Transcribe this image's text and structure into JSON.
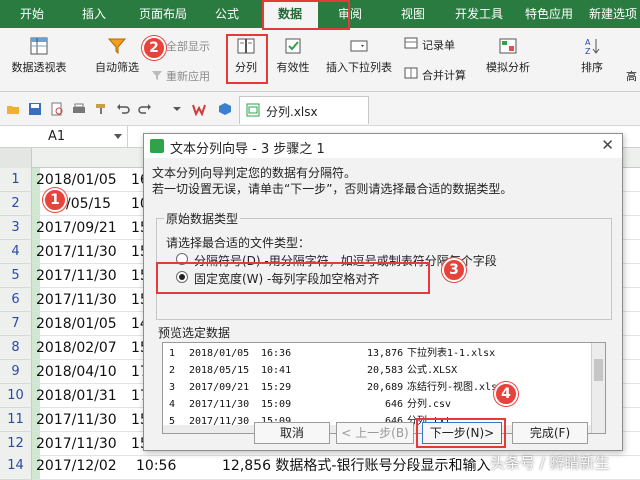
{
  "ribbon_tabs": [
    "开始",
    "插入",
    "页面布局",
    "公式",
    "数据",
    "审阅",
    "视图",
    "开发工具",
    "特色应用",
    "新建选项卡"
  ],
  "active_tab": "数据",
  "ribbon": {
    "pivot_table": "数据透视表",
    "auto_filter": "自动筛选",
    "show_all": "全部显示",
    "reapply": "重新应用",
    "split_column": "分列",
    "validity": "有效性",
    "insert_dropdown": "插入下拉列表",
    "record_sheet": "记录单",
    "merge_calc": "合并计算",
    "simulate_analysis": "模拟分析",
    "sort": "排序",
    "advanced": "高"
  },
  "quick_bar": {
    "file_tab": "分列.xlsx"
  },
  "name_box": "A1",
  "sheet": {
    "row_numbers": [
      "1",
      "2",
      "3",
      "4",
      "5",
      "6",
      "7",
      "8",
      "9",
      "10",
      "11",
      "12",
      "13",
      "14"
    ],
    "rows": [
      {
        "date": "2018/01/05",
        "time": "16",
        "rest": ""
      },
      {
        "date": "/05/15",
        "time": "10",
        "rest": ""
      },
      {
        "date": "2017/09/21",
        "time": "15",
        "rest": ""
      },
      {
        "date": "2017/11/30",
        "time": "15",
        "rest": ""
      },
      {
        "date": "2017/11/30",
        "time": "15",
        "rest": ""
      },
      {
        "date": "2017/11/30",
        "time": "15",
        "rest": ""
      },
      {
        "date": "2018/01/05",
        "time": "14",
        "rest": ""
      },
      {
        "date": "2018/02/07",
        "time": "15",
        "rest": ""
      },
      {
        "date": "2018/04/10",
        "time": "17",
        "rest": ""
      },
      {
        "date": "2018/01/31",
        "time": "17",
        "rest": ""
      },
      {
        "date": "2017/11/30",
        "time": "15",
        "rest": ""
      },
      {
        "date": "2017/11/30",
        "time": "15",
        "rest": ""
      },
      {
        "date": "2017/11/30",
        "time": "15",
        "rest": ""
      },
      {
        "date": "2017/12/02",
        "time": "10:56",
        "rest": "12,856 数据格式-银行账号分段显示和输入"
      }
    ]
  },
  "dialog": {
    "title": "文本分列向导 - 3 步骤之 1",
    "close": "✕",
    "intro_line1": "文本分列向导判定您的数据有分隔符。",
    "intro_line2": "若一切设置无误，请单击“下一步”，否则请选择最合适的数据类型。",
    "group_title": "原始数据类型",
    "choose_label": "请选择最合适的文件类型：",
    "option_delimited": "分隔符号(D)  -用分隔字符，如逗号或制表符分隔每个字段",
    "option_fixed": "固定宽度(W)  -每列字段加空格对齐",
    "selected_option": "fixed",
    "preview_title": "预览选定数据",
    "preview_rows": [
      {
        "n": "1",
        "date": "2018/01/05",
        "time": "16:36",
        "size": "13,876",
        "name": "下拉列表1-1.xlsx"
      },
      {
        "n": "2",
        "date": "2018/05/15",
        "time": "10:41",
        "size": "20,583",
        "name": "公式.XLSX"
      },
      {
        "n": "3",
        "date": "2017/09/21",
        "time": "15:29",
        "size": "20,689",
        "name": "冻结行列-视图.xlsx"
      },
      {
        "n": "4",
        "date": "2017/11/30",
        "time": "15:09",
        "size": "646",
        "name": "分列.csv"
      },
      {
        "n": "5",
        "date": "2017/11/30",
        "time": "15:09",
        "size": "646",
        "name": "分列.txt"
      }
    ],
    "buttons": {
      "cancel": "取消",
      "back": "< 上一步(B)",
      "next": "下一步(N)>",
      "finish": "完成(F)"
    }
  },
  "badges": [
    "1",
    "2",
    "3",
    "4"
  ],
  "watermark": "头条号 / 孵睛新生",
  "colors": {
    "tab_bar": "#2a7b3f",
    "accent_green": "#2ea34a",
    "annotation_red": "#e53a3a",
    "row_number_blue": "#2b4aa8"
  }
}
